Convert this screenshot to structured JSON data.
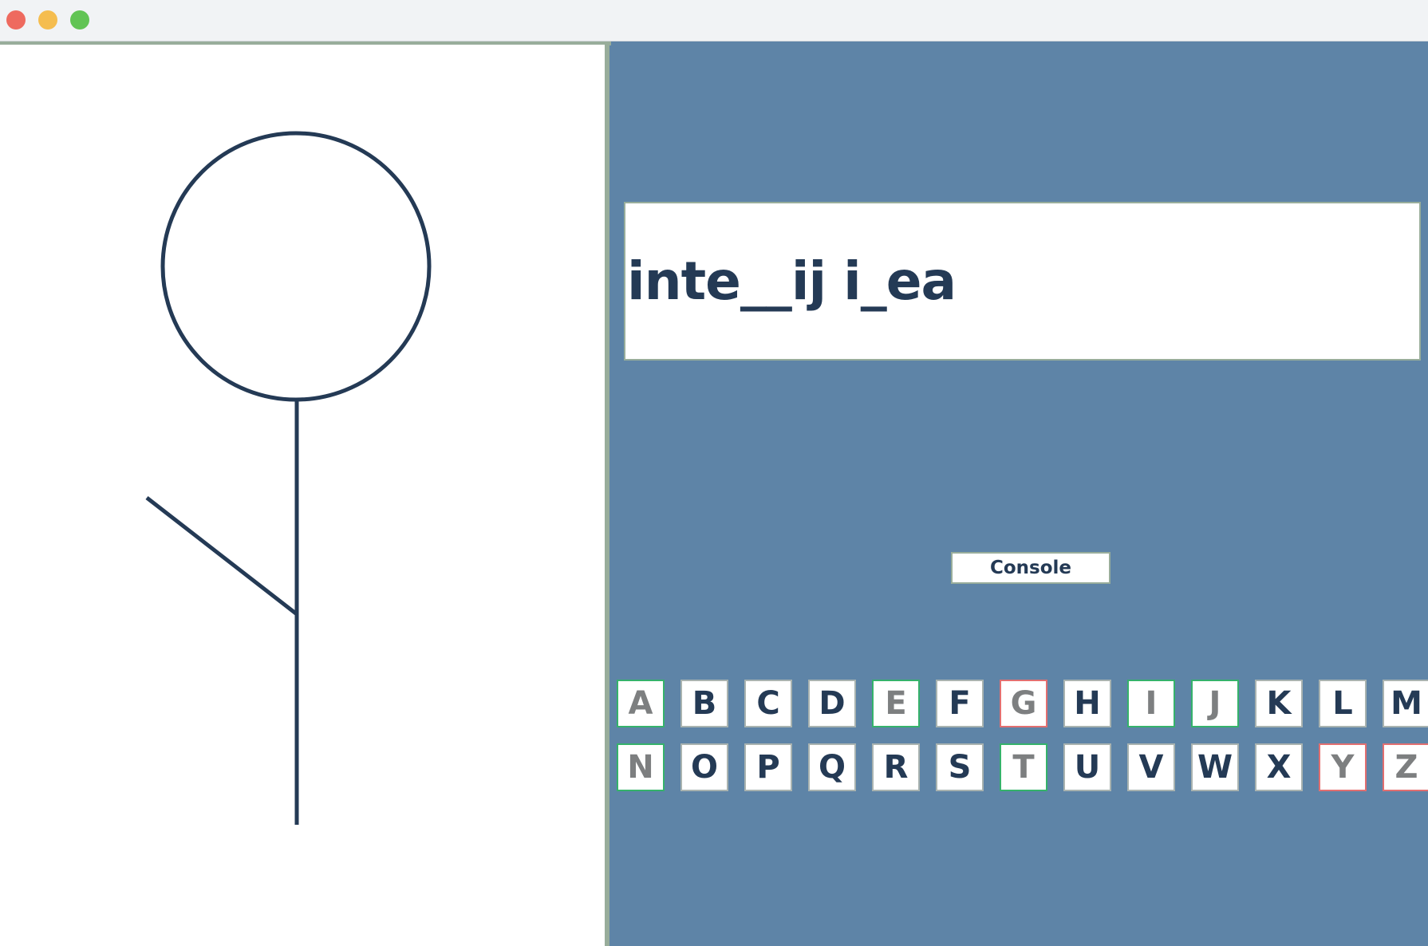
{
  "window": {
    "controls": {
      "close_color": "#ee6a5f",
      "minimize_color": "#f5bd4f",
      "maximize_color": "#61c454"
    }
  },
  "colors": {
    "panel_bg": "#5e84a7",
    "ink": "#243a55",
    "correct_border": "#35b26b",
    "wrong_border": "#e26f70",
    "panel_border": "#98ad9b"
  },
  "game": {
    "word_display": "inte__ij i_ea",
    "console_label": "Console",
    "hangman_parts_drawn": [
      "head",
      "body",
      "left-arm"
    ],
    "keyboard": {
      "row1": [
        {
          "letter": "A",
          "state": "correct"
        },
        {
          "letter": "B",
          "state": "unused"
        },
        {
          "letter": "C",
          "state": "unused"
        },
        {
          "letter": "D",
          "state": "unused"
        },
        {
          "letter": "E",
          "state": "correct"
        },
        {
          "letter": "F",
          "state": "unused"
        },
        {
          "letter": "G",
          "state": "wrong"
        },
        {
          "letter": "H",
          "state": "unused"
        },
        {
          "letter": "I",
          "state": "correct"
        },
        {
          "letter": "J",
          "state": "correct"
        },
        {
          "letter": "K",
          "state": "unused"
        },
        {
          "letter": "L",
          "state": "unused"
        },
        {
          "letter": "M",
          "state": "unused"
        }
      ],
      "row2": [
        {
          "letter": "N",
          "state": "correct"
        },
        {
          "letter": "O",
          "state": "unused"
        },
        {
          "letter": "P",
          "state": "unused"
        },
        {
          "letter": "Q",
          "state": "unused"
        },
        {
          "letter": "R",
          "state": "unused"
        },
        {
          "letter": "S",
          "state": "unused"
        },
        {
          "letter": "T",
          "state": "correct"
        },
        {
          "letter": "U",
          "state": "unused"
        },
        {
          "letter": "V",
          "state": "unused"
        },
        {
          "letter": "W",
          "state": "unused"
        },
        {
          "letter": "X",
          "state": "unused"
        },
        {
          "letter": "Y",
          "state": "wrong"
        },
        {
          "letter": "Z",
          "state": "wrong"
        }
      ]
    }
  }
}
